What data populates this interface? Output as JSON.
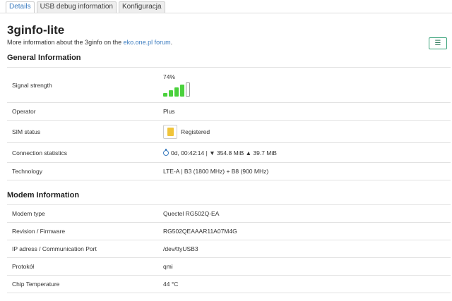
{
  "tabs": [
    {
      "label": "Details",
      "active": true
    },
    {
      "label": "USB debug information",
      "active": false
    },
    {
      "label": "Konfiguracja",
      "active": false
    }
  ],
  "header": {
    "title": "3ginfo-lite",
    "subtitle_prefix": "More information about the 3ginfo on the ",
    "subtitle_link": "eko.one.pl forum",
    "subtitle_suffix": ".",
    "menu_icon": "☰"
  },
  "general": {
    "section_title": "General Information",
    "signal": {
      "label": "Signal strength",
      "value": "74%",
      "percent": 74
    },
    "operator": {
      "label": "Operator",
      "value": "Plus"
    },
    "sim": {
      "label": "SIM status",
      "value": "Registered"
    },
    "connection": {
      "label": "Connection statistics",
      "value": "0d, 00:42:14 | ▼ 354.8 MiB ▲ 39.7 MiB"
    },
    "technology": {
      "label": "Technology",
      "value": "LTE-A | B3 (1800 MHz) + B8 (900 MHz)"
    }
  },
  "modem": {
    "section_title": "Modem Information",
    "rows": [
      {
        "label": "Modem type",
        "value": "Quectel RG502Q-EA"
      },
      {
        "label": "Revision / Firmware",
        "value": "RG502QEAAAR11A07M4G"
      },
      {
        "label": "IP adress / Communication Port",
        "value": "/dev/ttyUSB3"
      },
      {
        "label": "Protokół",
        "value": "qmi"
      },
      {
        "label": "Chip Temperature",
        "value": "44 °C"
      }
    ]
  },
  "colors": {
    "accent": "#3a7bbf",
    "signal": "#4ad13c",
    "sim": "#f0c43a",
    "menu_border": "#3aa37a"
  }
}
